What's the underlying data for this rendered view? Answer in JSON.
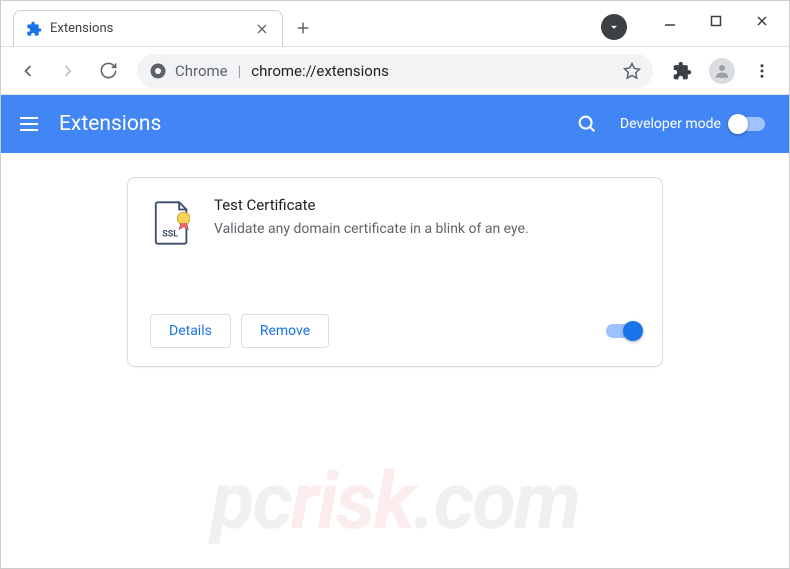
{
  "tab": {
    "title": "Extensions"
  },
  "omnibox": {
    "prefix": "Chrome",
    "url": "chrome://extensions"
  },
  "appbar": {
    "title": "Extensions",
    "devmode_label": "Developer mode",
    "devmode_on": false
  },
  "extension": {
    "name": "Test Certificate",
    "description": "Validate any domain certificate in a blink of an eye.",
    "enabled": true,
    "icon_badge": "SSL",
    "buttons": {
      "details": "Details",
      "remove": "Remove"
    }
  },
  "colors": {
    "accent": "#4285f4",
    "link": "#1a73e8"
  }
}
